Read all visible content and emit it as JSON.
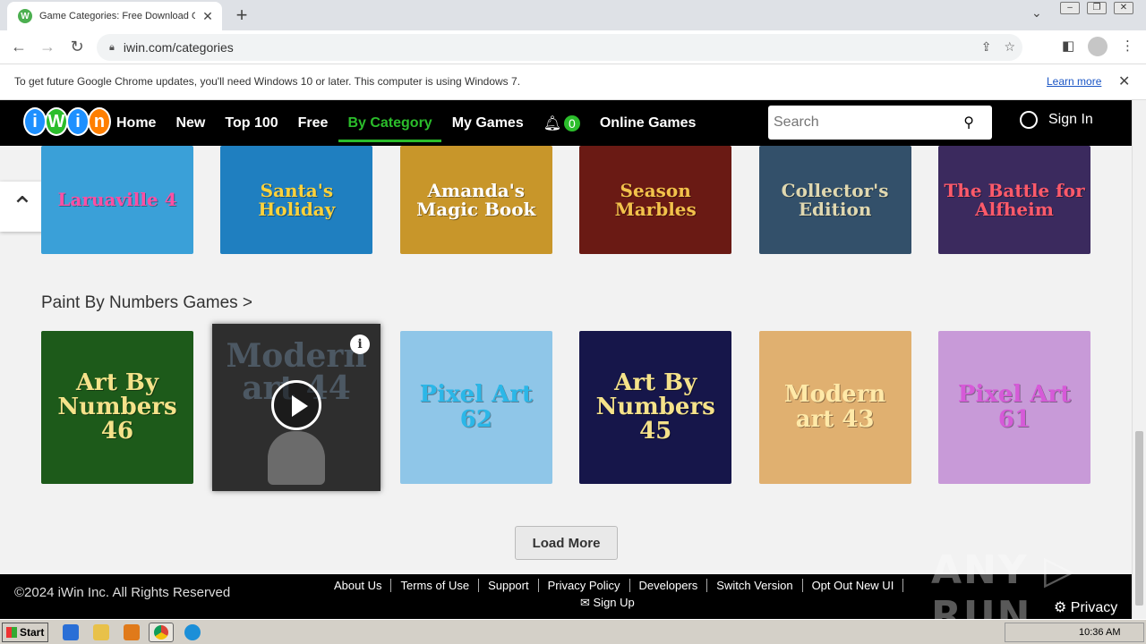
{
  "browser": {
    "tab_title": "Game Categories: Free Download G",
    "url": "iwin.com/categories",
    "infobar_message": "To get future Google Chrome updates, you'll need Windows 10 or later. This computer is using Windows 7.",
    "infobar_link": "Learn more"
  },
  "site": {
    "logo_letters": [
      "i",
      "W",
      "i",
      "n"
    ],
    "logo_colors": [
      "#1e90ff",
      "#2bbd2b",
      "#1e90ff",
      "#ff7f00"
    ],
    "nav": [
      "Home",
      "New",
      "Top 100",
      "Free",
      "By Category",
      "My Games"
    ],
    "notif_count": "0",
    "online_games": "Online Games",
    "search_placeholder": "Search",
    "signin": "Sign In"
  },
  "top_row": [
    {
      "title": "Laruaville 4",
      "bg": "#3aa0d8",
      "fg": "#ff4fa3"
    },
    {
      "title": "Santa's Holiday",
      "bg": "#1f7fc0",
      "fg": "#ffd23a"
    },
    {
      "title": "Amanda's Magic Book",
      "bg": "#c8962a",
      "fg": "#ffffff"
    },
    {
      "title": "Season Marbles",
      "bg": "#6a1a14",
      "fg": "#f3c24b"
    },
    {
      "title": "Collector's Edition",
      "bg": "#33506a",
      "fg": "#e0d8b0"
    },
    {
      "title": "The Battle for Alfheim",
      "bg": "#3b2a5e",
      "fg": "#ff5a6a"
    }
  ],
  "section_title": "Paint By Numbers Games >",
  "paint_row": [
    {
      "title": "Art By Numbers 46",
      "bg": "#1d5a1a",
      "fg": "#f5e28a"
    },
    {
      "title": "Modern art 44",
      "bg": "#2e2e2e",
      "fg": "#ffffff"
    },
    {
      "title": "Pixel Art 62",
      "bg": "#8fc6e8",
      "fg": "#2bb7e8"
    },
    {
      "title": "Art By Numbers 45",
      "bg": "#16164a",
      "fg": "#f5e28a"
    },
    {
      "title": "Modern art 43",
      "bg": "#e0b070",
      "fg": "#ffe9a8"
    },
    {
      "title": "Pixel Art 61",
      "bg": "#c89ad8",
      "fg": "#d65ad8"
    }
  ],
  "load_more": "Load More",
  "footer": {
    "copyright": "©2024 iWin Inc. All Rights Reserved",
    "links": [
      "About Us",
      "Terms of Use",
      "Support",
      "Privacy Policy",
      "Developers",
      "Switch Version",
      "Opt Out New UI"
    ],
    "signup": "✉ Sign Up",
    "privacy": "⚙ Privacy"
  },
  "watermark": "ANY ▷ RUN",
  "taskbar": {
    "start": "Start",
    "clock": "10:36 AM"
  }
}
